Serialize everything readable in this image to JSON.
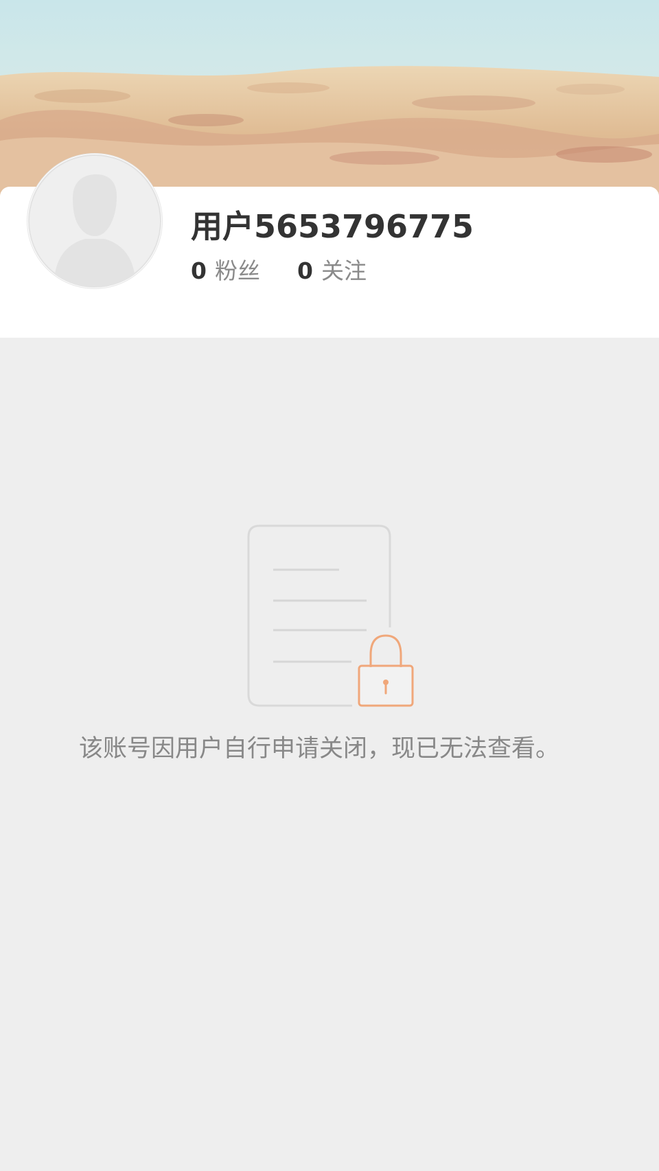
{
  "profile": {
    "username": "用户5653796775",
    "followers_count": "0",
    "followers_label": "粉丝",
    "following_count": "0",
    "following_label": "关注"
  },
  "status": {
    "message": "该账号因用户自行申请关闭，现已无法查看。"
  },
  "icons": {
    "avatar": "default-avatar-icon",
    "illustration": "locked-document-icon"
  },
  "colors": {
    "background": "#eeeeee",
    "card": "#ffffff",
    "text_primary": "#333333",
    "text_secondary": "#8a8a8a",
    "lock_accent": "#f0a77a"
  }
}
